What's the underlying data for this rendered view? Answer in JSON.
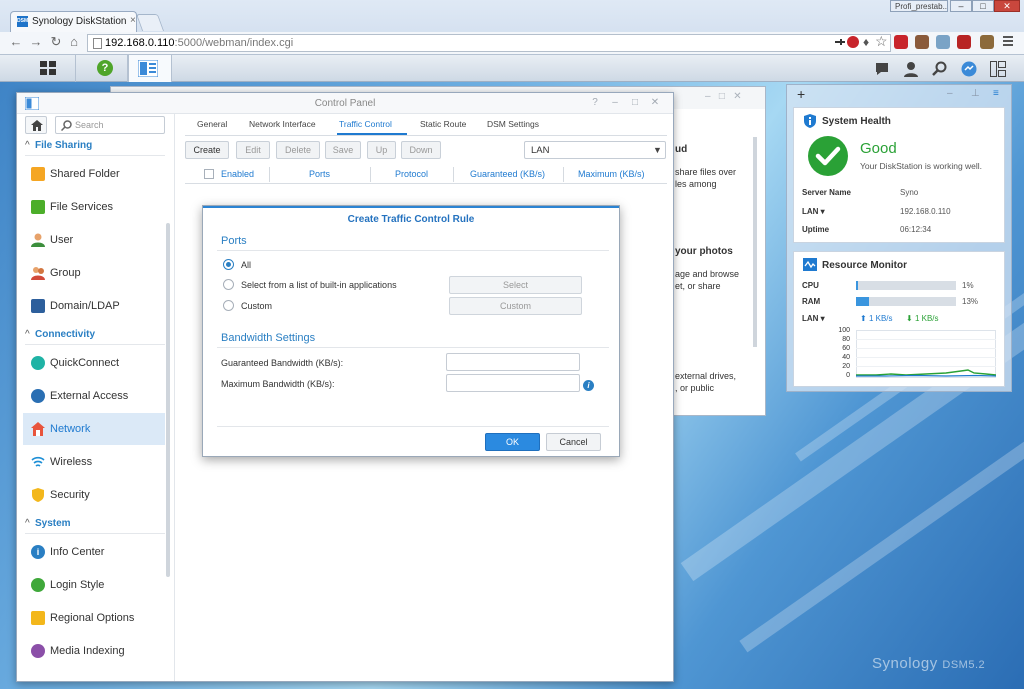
{
  "browser": {
    "tab_title": "Synology DiskStation - Sy",
    "tab_close": "×",
    "tab_favicon": "DSM",
    "profile": "Profi_prestab...",
    "url_host": "192.168.0.110",
    "url_rest": ":5000/webman/index.cgi",
    "win_min": "–",
    "win_max": "□",
    "win_close": "✕"
  },
  "control_panel": {
    "title": "Control Panel",
    "search_placeholder": "Search",
    "sections": [
      {
        "label": "File Sharing",
        "items": [
          "Shared Folder",
          "File Services",
          "User",
          "Group",
          "Domain/LDAP"
        ]
      },
      {
        "label": "Connectivity",
        "items": [
          "QuickConnect",
          "External Access",
          "Network",
          "Wireless",
          "Security"
        ]
      },
      {
        "label": "System",
        "items": [
          "Info Center",
          "Login Style",
          "Regional Options",
          "Media Indexing"
        ]
      }
    ],
    "selected_item": "Network",
    "tabs": [
      "General",
      "Network Interface",
      "Traffic Control",
      "Static Route",
      "DSM Settings"
    ],
    "active_tab": "Traffic Control",
    "toolbar": [
      "Create",
      "Edit",
      "Delete",
      "Save",
      "Up",
      "Down"
    ],
    "interface_select": "LAN",
    "columns": [
      "Enabled",
      "Ports",
      "Protocol",
      "Guaranteed (KB/s)",
      "Maximum (KB/s)"
    ]
  },
  "background_window": {
    "lines": [
      "ud",
      "share files over",
      "les among",
      "your photos",
      "age and browse",
      "et, or share",
      "external drives,",
      ", or public"
    ]
  },
  "dialog": {
    "title": "Create Traffic Control Rule",
    "ports_heading": "Ports",
    "options": [
      "All",
      "Select from a list of built-in applications",
      "Custom"
    ],
    "selected_option": "All",
    "select_button": "Select",
    "custom_button": "Custom",
    "bandwidth_heading": "Bandwidth Settings",
    "guaranteed_label": "Guaranteed Bandwidth (KB/s):",
    "maximum_label": "Maximum Bandwidth (KB/s):",
    "guaranteed_value": "",
    "maximum_value": "",
    "info_glyph": "i",
    "ok": "OK",
    "cancel": "Cancel"
  },
  "system_health": {
    "title": "System Health",
    "status": "Good",
    "message": "Your DiskStation is working well.",
    "rows": [
      {
        "key": "Server Name",
        "value": "Syno"
      },
      {
        "key": "LAN ▾",
        "value": "192.168.0.110"
      },
      {
        "key": "Uptime",
        "value": "06:12:34"
      }
    ]
  },
  "resource_monitor": {
    "title": "Resource Monitor",
    "cpu_label": "CPU",
    "cpu_percent": 1,
    "cpu_text": "1%",
    "ram_label": "RAM",
    "ram_percent": 13,
    "ram_text": "13%",
    "lan_label": "LAN ▾",
    "upload": "1 KB/s",
    "download": "1 KB/s",
    "y_ticks": [
      "100",
      "80",
      "60",
      "40",
      "20",
      "0"
    ]
  },
  "branding": {
    "name": "Synology",
    "version": "DSM5.2"
  },
  "colors": {
    "accent": "#1f7ad0",
    "good": "#2aa136",
    "ok_button": "#2b8ae0"
  }
}
